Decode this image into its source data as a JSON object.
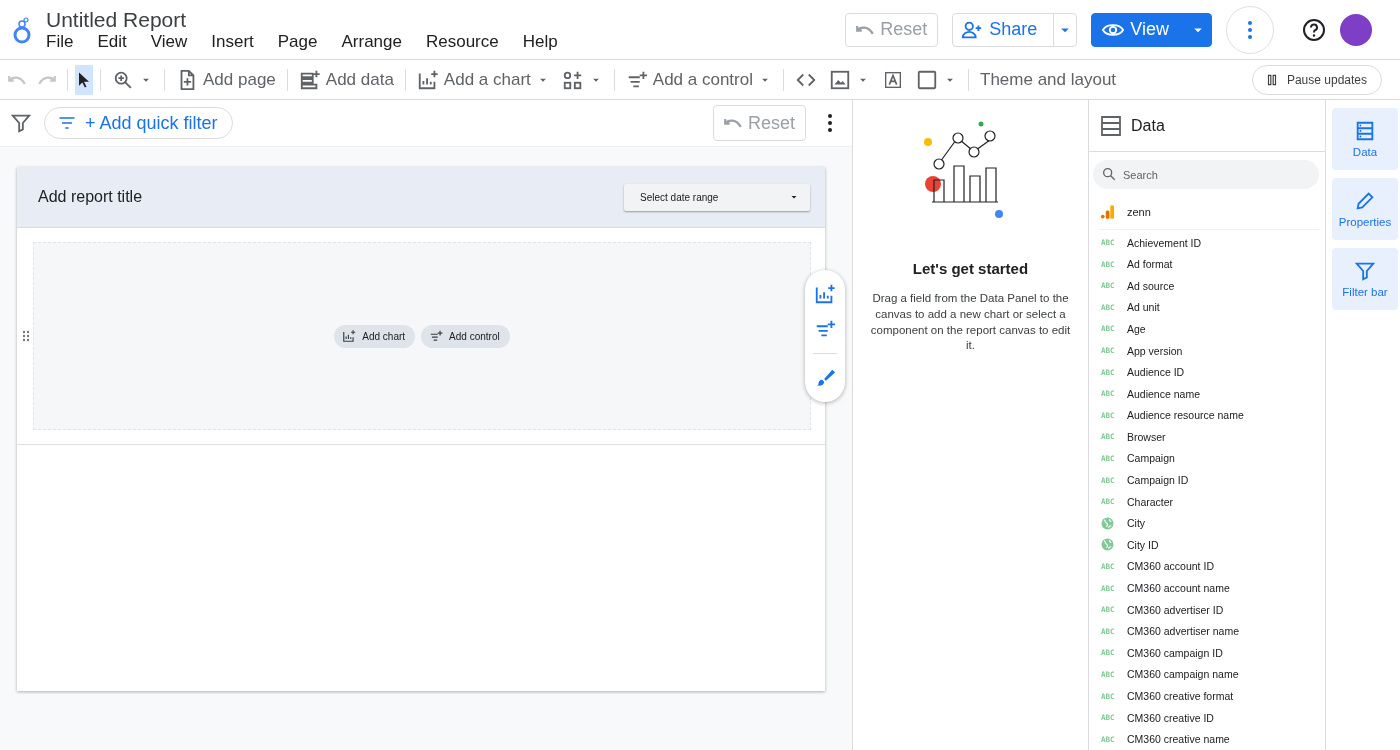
{
  "header": {
    "title": "Untitled Report",
    "menu": [
      "File",
      "Edit",
      "View",
      "Insert",
      "Page",
      "Arrange",
      "Resource",
      "Help"
    ],
    "reset": {
      "label": "Reset",
      "disabled": true
    },
    "share": "Share",
    "view": "View"
  },
  "toolbar": {
    "undo_disabled": true,
    "redo_disabled": true,
    "select_selected": true,
    "items": [
      {
        "label": "Add page",
        "caret": false
      },
      {
        "label": "Add data",
        "caret": false
      },
      {
        "label": "Add a chart",
        "caret": true
      },
      {
        "caret": true
      },
      {
        "label": "Add a control",
        "caret": true
      }
    ],
    "tools": [
      {
        "caret": false
      },
      {
        "caret": true
      },
      {
        "caret": false
      },
      {
        "caret": true
      }
    ],
    "theme": "Theme and layout",
    "pause": "Pause updates"
  },
  "filter_bar": {
    "add_filter": "+ Add quick filter",
    "reset": {
      "label": "Reset",
      "disabled": true
    }
  },
  "canvas": {
    "report_title": "Add report title",
    "date_range": "Select date range",
    "add_chart": "Add chart",
    "add_control": "Add control"
  },
  "start_panel": {
    "heading": "Let's get started",
    "description": "Drag a field from the Data Panel to the canvas to add a new chart or select a component on the report canvas to edit it."
  },
  "data_panel": {
    "title": "Data",
    "search": {
      "placeholder": "Search"
    },
    "source": "zenn",
    "fields": [
      {
        "kind": "text",
        "type_label": "ABC",
        "name": "Achievement ID"
      },
      {
        "kind": "text",
        "type_label": "ABC",
        "name": "Ad format"
      },
      {
        "kind": "text",
        "type_label": "ABC",
        "name": "Ad source"
      },
      {
        "kind": "text",
        "type_label": "ABC",
        "name": "Ad unit"
      },
      {
        "kind": "text",
        "type_label": "ABC",
        "name": "Age"
      },
      {
        "kind": "text",
        "type_label": "ABC",
        "name": "App version"
      },
      {
        "kind": "text",
        "type_label": "ABC",
        "name": "Audience ID"
      },
      {
        "kind": "text",
        "type_label": "ABC",
        "name": "Audience name"
      },
      {
        "kind": "text",
        "type_label": "ABC",
        "name": "Audience resource name"
      },
      {
        "kind": "text",
        "type_label": "ABC",
        "name": "Browser"
      },
      {
        "kind": "text",
        "type_label": "ABC",
        "name": "Campaign"
      },
      {
        "kind": "text",
        "type_label": "ABC",
        "name": "Campaign ID"
      },
      {
        "kind": "text",
        "type_label": "ABC",
        "name": "Character"
      },
      {
        "kind": "geo",
        "name": "City"
      },
      {
        "kind": "geo",
        "name": "City ID"
      },
      {
        "kind": "text",
        "type_label": "ABC",
        "name": "CM360 account ID"
      },
      {
        "kind": "text",
        "type_label": "ABC",
        "name": "CM360 account name"
      },
      {
        "kind": "text",
        "type_label": "ABC",
        "name": "CM360 advertiser ID"
      },
      {
        "kind": "text",
        "type_label": "ABC",
        "name": "CM360 advertiser name"
      },
      {
        "kind": "text",
        "type_label": "ABC",
        "name": "CM360 campaign ID"
      },
      {
        "kind": "text",
        "type_label": "ABC",
        "name": "CM360 campaign name"
      },
      {
        "kind": "text",
        "type_label": "ABC",
        "name": "CM360 creative format"
      },
      {
        "kind": "text",
        "type_label": "ABC",
        "name": "CM360 creative ID"
      },
      {
        "kind": "text",
        "type_label": "ABC",
        "name": "CM360 creative name"
      }
    ]
  },
  "rail": [
    {
      "label": "Data"
    },
    {
      "label": "Properties"
    },
    {
      "label": "Filter bar"
    }
  ]
}
